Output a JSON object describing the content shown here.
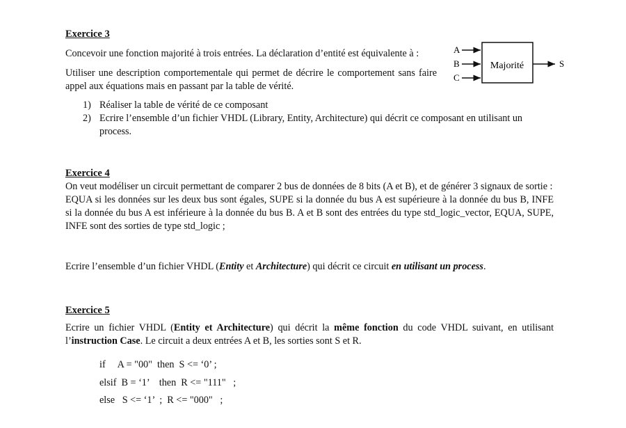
{
  "ex3": {
    "title": "Exercice 3",
    "intro": "Concevoir une fonction majorité à trois entrées. La déclaration d’entité est équivalente à :",
    "para": "Utiliser une description comportementale qui permet de décrire le comportement sans faire appel aux équations mais en passant par la table de vérité.",
    "items": [
      {
        "num": "1)",
        "text": "Réaliser la table de vérité de ce composant"
      },
      {
        "num": "2)",
        "text": "Ecrire l’ensemble d’un fichier VHDL (Library, Entity, Architecture) qui décrit ce composant en utilisant un process."
      }
    ],
    "diagram": {
      "block_label": "Majorité",
      "inputs": [
        "A",
        "B",
        "C"
      ],
      "output": "S"
    }
  },
  "ex4": {
    "title": "Exercice 4",
    "para1": "On veut modéliser un circuit permettant de comparer 2 bus de données de 8 bits (A et B), et de générer 3 signaux de sortie :",
    "para2": "EQUA si les données sur les deux bus sont égales, SUPE si la donnée du bus A est supérieure à la donnée du bus B, INFE si la donnée du bus A est inférieure à la donnée du bus B. A et B sont des entrées du type std_logic_vector, EQUA, SUPE, INFE sont des sorties de type std_logic ;",
    "task": {
      "prefix": "Ecrire l’ensemble d’un fichier VHDL (",
      "entity": "Entity",
      "et": " et ",
      "architecture": "Architecture",
      "middle": ") qui décrit ce circuit ",
      "emphasis": "en utilisant un process",
      "suffix": "."
    }
  },
  "ex5": {
    "title": "Exercice 5",
    "text": {
      "part1": "Ecrire un fichier VHDL (",
      "bold1": "Entity et Architecture",
      "part2": ") qui décrit la ",
      "bold2": "même fonction",
      "part3": " du code VHDL suivant, en utilisant l’",
      "bold3": "instruction Case",
      "part4": ". Le circuit a deux entrées A et B, les sorties sont S et R."
    },
    "code": [
      "if     A = \"00\"  then  S <= ‘0’ ;",
      "elsif  B = ‘1’    then  R <= \"111\"   ;",
      "else   S <= ‘1’  ;  R <= \"000\"   ;"
    ]
  }
}
